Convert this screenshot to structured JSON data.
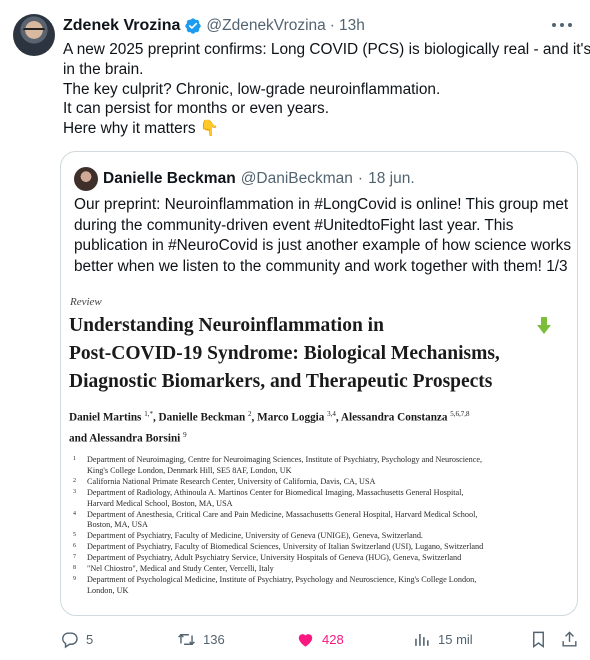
{
  "tweet": {
    "author": {
      "name": "Zdenek Vrozina",
      "handle": "@ZdenekVrozina",
      "time": "13h",
      "verified": true
    },
    "lines": [
      "A new 2025 preprint confirms: Long COVID (PCS) is biologically real - and it's",
      "in the brain.",
      "The key culprit? Chronic, low-grade neuroinflammation.",
      "It can persist for months or even years.",
      "Here why it matters 👇"
    ]
  },
  "quote": {
    "author": {
      "name": "Danielle Beckman",
      "handle": "@DaniBeckman",
      "time": "18 jun."
    },
    "lines": [
      "Our preprint: Neuroinflammation in #LongCovid is online! This group met",
      "during the community-driven event #UnitedtoFight last year. This",
      "publication in #NeuroCovid is just another example of how science works",
      "better when we listen to the community and work together with them! 1/3"
    ],
    "paper": {
      "label": "Review",
      "title_lines": [
        "Understanding Neuroinflammation in",
        "Post-COVID-19 Syndrome: Biological Mechanisms,",
        "Diagnostic Biomarkers, and Therapeutic Prospects"
      ],
      "authors": [
        {
          "name": "Daniel Martins",
          "sup": "1,*"
        },
        {
          "name": "Danielle Beckman",
          "sup": "2"
        },
        {
          "name": "Marco Loggia",
          "sup": "3,4"
        },
        {
          "name": "Alessandra Constanza",
          "sup": "5,6,7,8"
        },
        {
          "name": "Alessandra Borsini",
          "sup": "9"
        }
      ],
      "affiliations": [
        {
          "num": "1",
          "lines": [
            "Department of Neuroimaging, Centre for Neuroimaging Sciences, Institute of Psychiatry, Psychology and Neuroscience,",
            "King's College London, Denmark Hill, SE5 8AF, London, UK"
          ]
        },
        {
          "num": "2",
          "lines": [
            "California National Primate Research Center, University of California, Davis, CA, USA"
          ]
        },
        {
          "num": "3",
          "lines": [
            "Department of Radiology, Athinoula A. Martinos Center for Biomedical Imaging, Massachusetts General Hospital,",
            "Harvard Medical School, Boston, MA, USA"
          ]
        },
        {
          "num": "4",
          "lines": [
            "Department of Anesthesia, Critical Care and Pain Medicine, Massachusetts General Hospital, Harvard Medical School,",
            "Boston, MA, USA"
          ]
        },
        {
          "num": "5",
          "lines": [
            "Department of Psychiatry, Faculty of Medicine, University of Geneva (UNIGE), Geneva, Switzerland."
          ]
        },
        {
          "num": "6",
          "lines": [
            "Department of Psychiatry, Faculty of Biomedical Sciences, University of Italian Switzerland (USI), Lugano, Switzerland"
          ]
        },
        {
          "num": "7",
          "lines": [
            "Department of Psychiatry, Adult Psychiatry Service, University Hospitals of Geneva (HUG), Geneva, Switzerland"
          ]
        },
        {
          "num": "8",
          "lines": [
            "\"Nel Chiostro\", Medical and Study Center, Vercelli, Italy"
          ]
        },
        {
          "num": "9",
          "lines": [
            "Department of Psychological Medicine, Institute of Psychiatry, Psychology and Neuroscience, King's College London,",
            "London, UK"
          ]
        }
      ]
    }
  },
  "actions": {
    "replies": "5",
    "reposts": "136",
    "likes": "428",
    "views": "15 mil"
  },
  "colors": {
    "text": "#0f1419",
    "secondary": "#536471",
    "border": "#cfd9de",
    "verified": "#1d9bf0",
    "like": "#f91880"
  }
}
